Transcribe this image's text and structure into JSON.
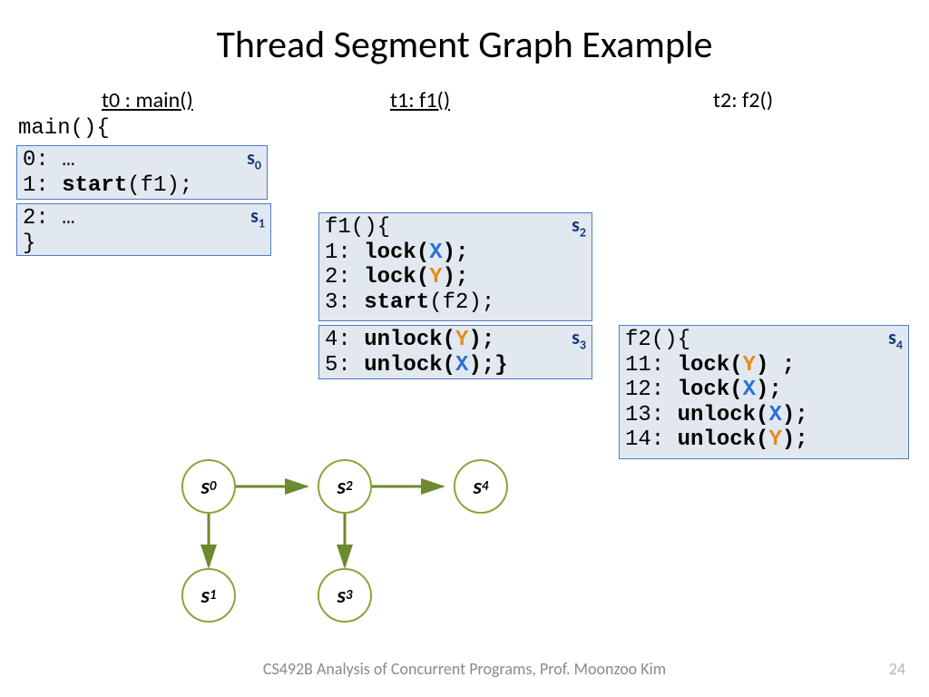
{
  "title": "Thread Segment Graph Example",
  "columns": {
    "t0": "t0 : main()",
    "t1": "t1: f1()",
    "t2": "t2: f2()"
  },
  "main_decl": "main(){",
  "segments": {
    "s0": {
      "tag_base": "s",
      "tag_sub": "0",
      "lines": [
        "0: …",
        "1: start(f1);"
      ]
    },
    "s1": {
      "tag_base": "s",
      "tag_sub": "1",
      "lines": [
        "2: …",
        "}"
      ]
    },
    "s2": {
      "tag_base": "s",
      "tag_sub": "2",
      "header": "  f1(){",
      "lines": [
        "1: lock(X);",
        "2: lock(Y);",
        "3: start(f2);"
      ]
    },
    "s3": {
      "tag_base": "s",
      "tag_sub": "3",
      "lines": [
        "4: unlock(Y);",
        "5: unlock(X);}"
      ]
    },
    "s4": {
      "tag_base": "s",
      "tag_sub": "4",
      "header": "  f2(){",
      "lines": [
        "11: lock(Y) ;",
        "12: lock(X);",
        "13: unlock(X);",
        "14: unlock(Y);"
      ]
    }
  },
  "graph": {
    "nodes": {
      "n0": {
        "base": "s",
        "sub": "0"
      },
      "n1": {
        "base": "s",
        "sub": "1"
      },
      "n2": {
        "base": "s",
        "sub": "2"
      },
      "n3": {
        "base": "s",
        "sub": "3"
      },
      "n4": {
        "base": "s",
        "sub": "4"
      }
    }
  },
  "footer": "CS492B Analysis of Concurrent Programs, Prof. Moonzoo Kim",
  "page_number": "24"
}
